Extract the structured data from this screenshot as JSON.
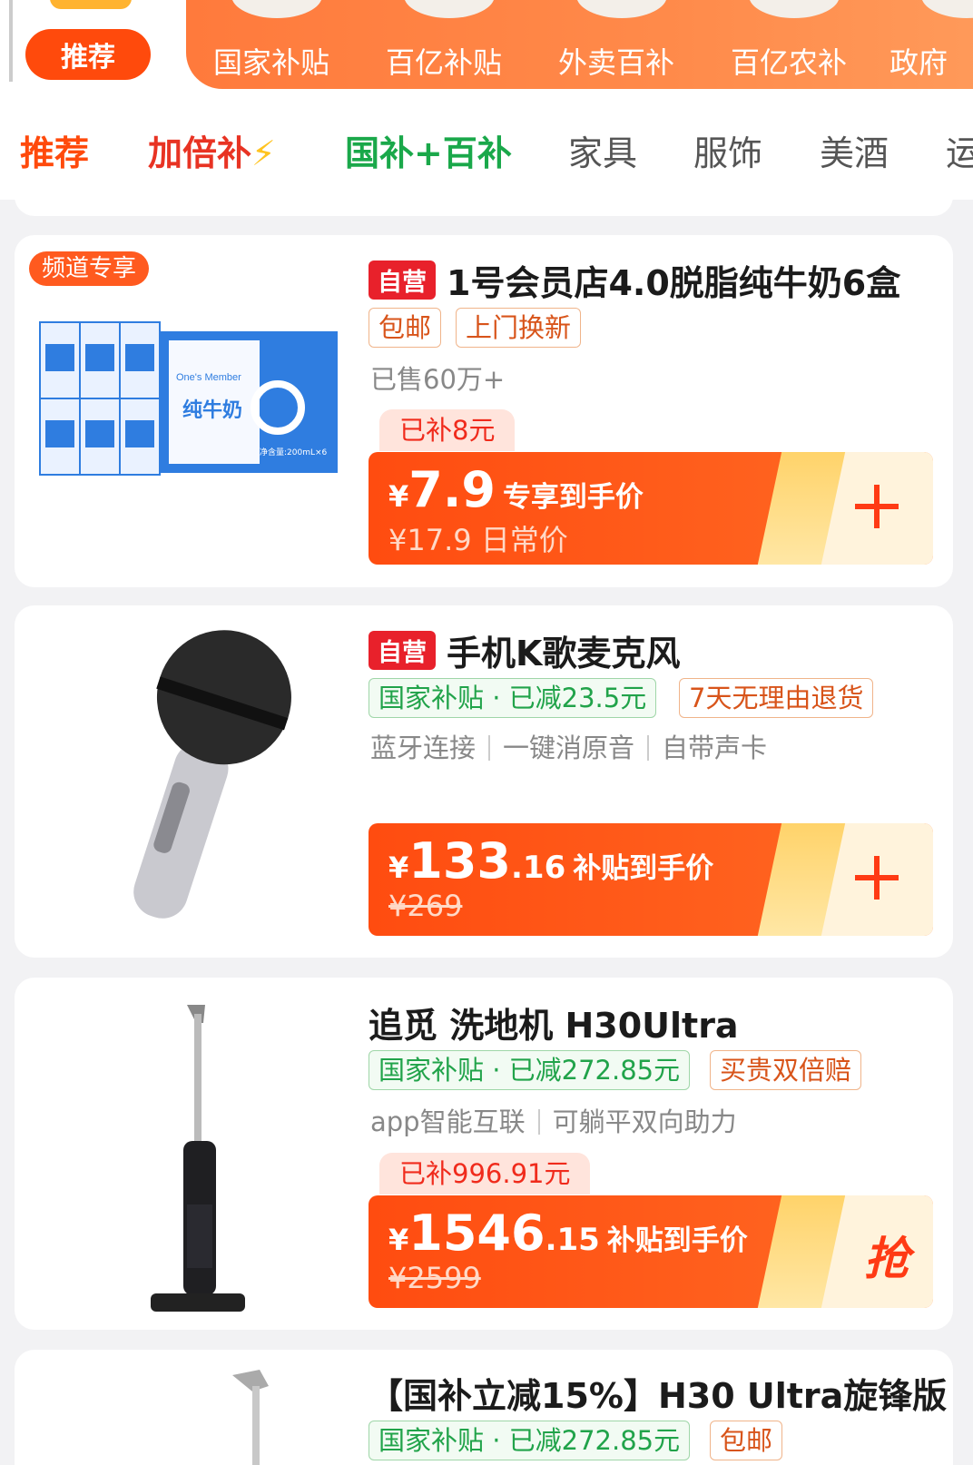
{
  "top_nav": {
    "active_pill": "推荐",
    "categories": [
      "国家补贴",
      "百亿补贴",
      "外卖百补",
      "百亿农补",
      "政府"
    ]
  },
  "tabs": {
    "items": [
      "推荐",
      "加倍补",
      "国补+百补",
      "家具",
      "服饰",
      "美酒",
      "运"
    ],
    "active": "推荐"
  },
  "colors": {
    "brand_orange": "#ff4a0c",
    "self_operated_red": "#e8212b",
    "subsidy_green": "#21a34a"
  },
  "products": [
    {
      "badge": "频道专享",
      "self_operated": "自营",
      "title": "1号会员店4.0脱脂纯牛奶6盒",
      "tags": [
        "包邮",
        "上门换新"
      ],
      "sold": "已售60万+",
      "subsidy": "已补8元",
      "price_yen": "¥",
      "price_int": "7.9",
      "price_dec": "",
      "price_label": "专享到手价",
      "orig_price": "¥17.9 日常价",
      "action_icon": "plus-icon",
      "image_text": {
        "brand": "One's Member",
        "product": "纯牛奶",
        "spec": "净含量:200mL×6"
      }
    },
    {
      "self_operated": "自营",
      "title": "手机K歌麦克风",
      "tags": [
        "国家补贴 · 已减23.5元",
        "7天无理由退货"
      ],
      "features": [
        "蓝牙连接",
        "一键消原音",
        "自带声卡"
      ],
      "price_yen": "¥",
      "price_int": "133",
      "price_dec": ".16",
      "price_label": "补贴到手价",
      "orig_price": "¥269",
      "action_icon": "plus-icon"
    },
    {
      "title": "追觅 洗地机 H30Ultra",
      "tags": [
        "国家补贴 · 已减272.85元",
        "买贵双倍赔"
      ],
      "features": [
        "app智能互联",
        "可躺平双向助力"
      ],
      "subsidy": "已补996.91元",
      "price_yen": "¥",
      "price_int": "1546",
      "price_dec": ".15",
      "price_label": "补贴到手价",
      "orig_price": "¥2599",
      "action_label": "抢"
    },
    {
      "title": "【国补立减15%】H30 Ultra旋锋版",
      "tags": [
        "国家补贴 · 已减272.85元",
        "包邮"
      ]
    }
  ]
}
